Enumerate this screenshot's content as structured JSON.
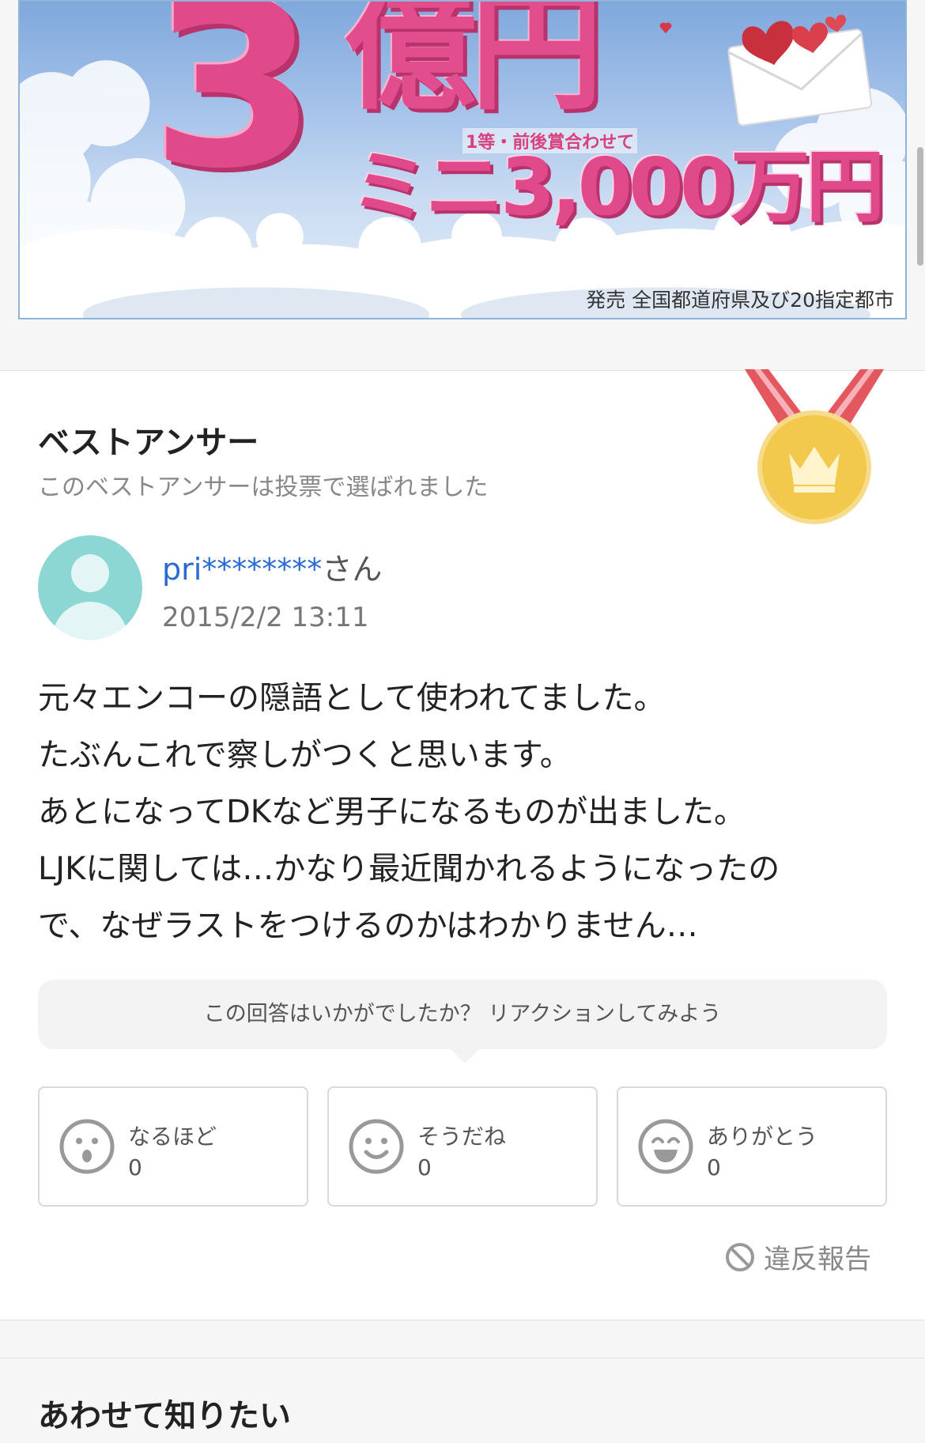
{
  "ad": {
    "big_number": "3",
    "unit": "億円",
    "sub_caption": "1等・前後賞合わせて",
    "mini_prize": "ミニ3,000万円",
    "footnote": "発売 全国都道府県及び20指定都市"
  },
  "best_answer": {
    "title": "ベストアンサー",
    "subtitle": "このベストアンサーは投票で選ばれました",
    "user": {
      "name": "pri********",
      "suffix": "さん",
      "date": "2015/2/2 13:11"
    },
    "body_lines": [
      "元々エンコーの隠語として使われてました。",
      "たぶんこれで察しがつくと思います。",
      "あとになってDKなど男子になるものが出ました。",
      "LJKに関しては…かなり最近聞かれるようになったの",
      "で、なぜラストをつけるのかはわかりません…"
    ],
    "reaction_prompt": "この回答はいかがでしたか？ リアクションしてみよう",
    "reactions": [
      {
        "label": "なるほど",
        "count": "0",
        "icon": "surprised-face-icon"
      },
      {
        "label": "そうだね",
        "count": "0",
        "icon": "smile-face-icon"
      },
      {
        "label": "ありがとう",
        "count": "0",
        "icon": "grin-face-icon"
      }
    ],
    "report_label": "違反報告",
    "medal_icon": "crown-medal-icon"
  },
  "related": {
    "title": "あわせて知りたい"
  },
  "colors": {
    "username": "#2a6bd1",
    "medal_gold": "#f2c94c",
    "ribbon": "#e4575f",
    "avatar": "#8cd6d4"
  }
}
